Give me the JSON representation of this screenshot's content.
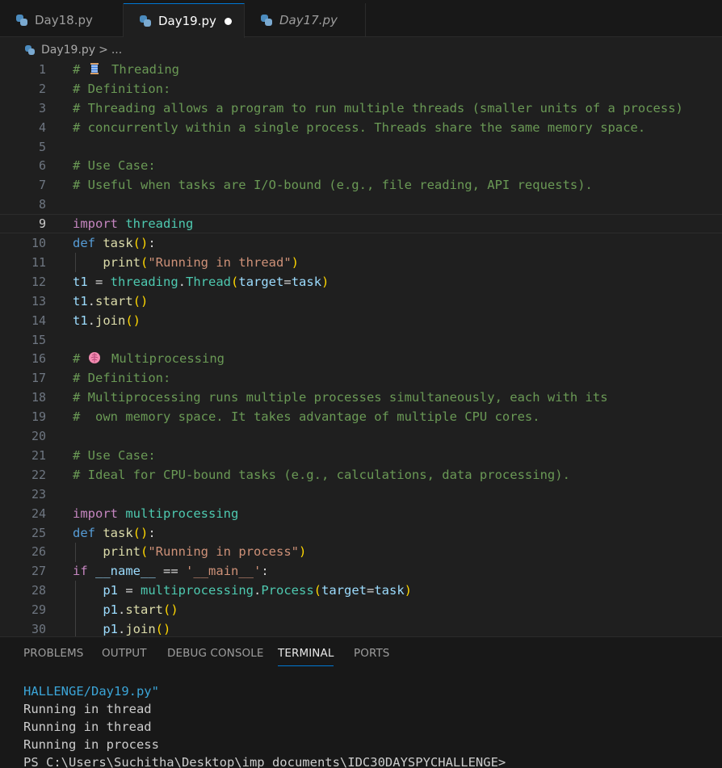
{
  "tabs": [
    {
      "label": "Day18.py",
      "active": false,
      "modified": false
    },
    {
      "label": "Day19.py",
      "active": true,
      "modified": true
    },
    {
      "label": "Day17.py",
      "active": false,
      "modified": false
    }
  ],
  "breadcrumb": {
    "file": "Day19.py",
    "separator": ">",
    "more": "..."
  },
  "editor": {
    "current_line": 9,
    "line_numbers": [
      "1",
      "2",
      "3",
      "4",
      "5",
      "6",
      "7",
      "8",
      "9",
      "10",
      "11",
      "12",
      "13",
      "14",
      "15",
      "16",
      "17",
      "18",
      "19",
      "20",
      "21",
      "22",
      "23",
      "24",
      "25",
      "26",
      "27",
      "28",
      "29",
      "30"
    ],
    "lines": {
      "l1_a": "# ",
      "l1_b": " Threading",
      "l2": "# Definition:",
      "l3": "# Threading allows a program to run multiple threads (smaller units of a process)",
      "l4": "# concurrently within a single process. Threads share the same memory space.",
      "l6": "# Use Case:",
      "l7": "# Useful when tasks are I/O-bound (e.g., file reading, API requests).",
      "l9_kw": "import",
      "l9_mod": "threading",
      "l10_kw": "def",
      "l10_fn": "task",
      "l11_fn": "print",
      "l11_str": "\"Running in thread\"",
      "l12_var": "t1",
      "l12_mod": "threading",
      "l12_cls": "Thread",
      "l12_arg": "target",
      "l12_val": "task",
      "l13_var": "t1",
      "l13_fn": "start",
      "l14_var": "t1",
      "l14_fn": "join",
      "l16_a": "# ",
      "l16_b": " Multiprocessing",
      "l17": "# Definition:",
      "l18": "# Multiprocessing runs multiple processes simultaneously, each with its",
      "l19": "#  own memory space. It takes advantage of multiple CPU cores.",
      "l21": "# Use Case:",
      "l22": "# Ideal for CPU-bound tasks (e.g., calculations, data processing).",
      "l24_kw": "import",
      "l24_mod": "multiprocessing",
      "l25_kw": "def",
      "l25_fn": "task",
      "l26_fn": "print",
      "l26_str": "\"Running in process\"",
      "l27_kw": "if",
      "l27_var": "__name__",
      "l27_op": "==",
      "l27_str": "'__main__'",
      "l28_var": "p1",
      "l28_mod": "multiprocessing",
      "l28_cls": "Process",
      "l28_arg": "target",
      "l28_val": "task",
      "l29_var": "p1",
      "l29_fn": "start",
      "l30_var": "p1",
      "l30_fn": "join"
    }
  },
  "panel": {
    "tabs": [
      "PROBLEMS",
      "OUTPUT",
      "DEBUG CONSOLE",
      "TERMINAL",
      "PORTS"
    ],
    "active_tab": "TERMINAL",
    "terminal_lines": [
      "HALLENGE/Day19.py\"",
      "Running in thread",
      "Running in thread",
      "Running in process",
      "PS C:\\Users\\Suchitha\\Desktop\\imp documents\\IDC30DAYSPYCHALLENGE>"
    ]
  },
  "colors": {
    "accent": "#0078d4",
    "comment": "#6a9955",
    "keyword": "#569cd6",
    "string": "#ce9178",
    "module": "#4ec9b0"
  },
  "icons": [
    "python-file-icon",
    "modified-dot-icon",
    "thread-spool-emoji",
    "brain-emoji"
  ]
}
